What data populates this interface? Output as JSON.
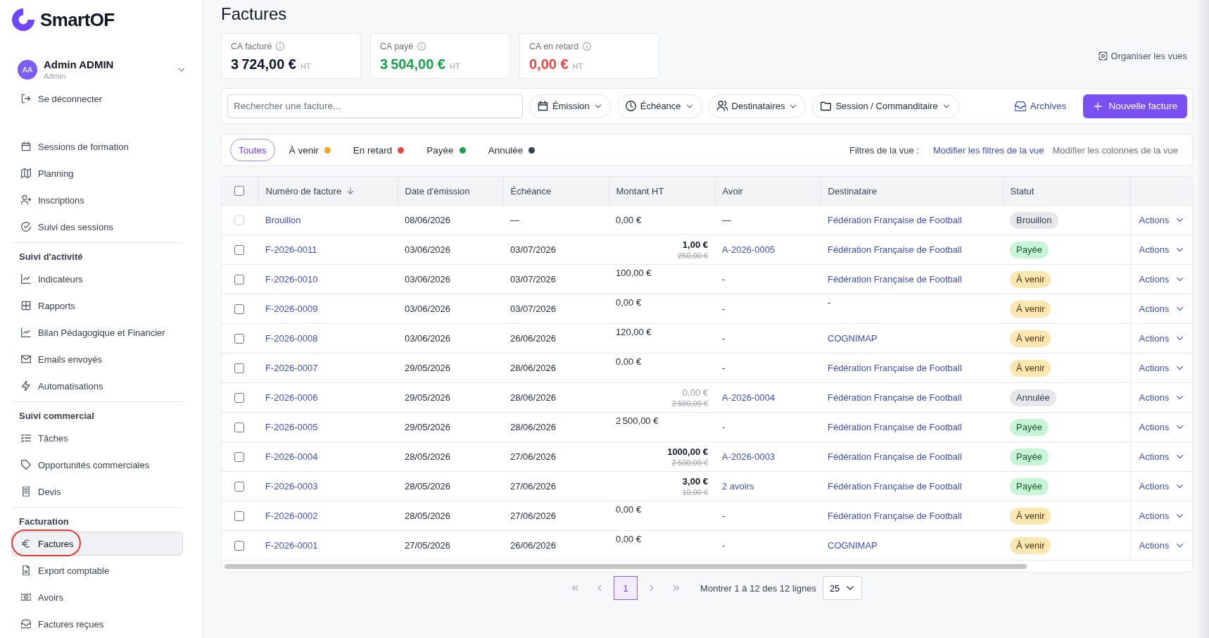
{
  "sidebar": {
    "brand": "SmartOF",
    "user": {
      "initials": "AA",
      "name": "Admin ADMIN",
      "role": "Admin"
    },
    "logout": "Se déconnecter",
    "sections": [
      {
        "items": [
          {
            "label": "Sessions de formation",
            "selected": false,
            "circled": false
          },
          {
            "label": "Planning",
            "selected": false,
            "circled": false
          },
          {
            "label": "Inscriptions",
            "selected": false,
            "circled": false
          },
          {
            "label": "Suivi des sessions",
            "selected": false,
            "circled": false
          }
        ]
      },
      {
        "title": "Suivi d'activité",
        "items": [
          {
            "label": "Indicateurs",
            "selected": false,
            "circled": false
          },
          {
            "label": "Rapports",
            "selected": false,
            "circled": false
          },
          {
            "label": "Bilan Pédagogique et Financier",
            "selected": false,
            "circled": false
          },
          {
            "label": "Emails envoyés",
            "selected": false,
            "circled": false
          },
          {
            "label": "Automatisations",
            "selected": false,
            "circled": false
          }
        ]
      },
      {
        "title": "Suivi commercial",
        "items": [
          {
            "label": "Tâches",
            "selected": false,
            "circled": false
          },
          {
            "label": "Opportunités commerciales",
            "selected": false,
            "circled": false
          },
          {
            "label": "Devis",
            "selected": false,
            "circled": false
          }
        ]
      },
      {
        "title": "Facturation",
        "items": [
          {
            "label": "Factures",
            "selected": true,
            "circled": true
          },
          {
            "label": "Export comptable",
            "selected": false,
            "circled": false
          },
          {
            "label": "Avoirs",
            "selected": false,
            "circled": false
          },
          {
            "label": "Factures reçues",
            "selected": false,
            "circled": false
          }
        ]
      }
    ]
  },
  "page": {
    "title": "Factures",
    "organize_views": "Organiser les vues"
  },
  "stats": [
    {
      "label": "CA facturé",
      "value": "3 724,00 €",
      "unit": "HT",
      "kind": "total"
    },
    {
      "label": "CA payé",
      "value": "3 504,00 €",
      "unit": "HT",
      "kind": "paid"
    },
    {
      "label": "CA en retard",
      "value": "0,00 €",
      "unit": "HT",
      "kind": "overdue"
    }
  ],
  "toolbar": {
    "search": {
      "placeholder": "Rechercher une facture..."
    },
    "filters": [
      {
        "label": "Émission"
      },
      {
        "label": "Échéance"
      },
      {
        "label": "Destinataires"
      },
      {
        "label": "Session / Commanditaire"
      }
    ],
    "archives": "Archives",
    "new_button": "Nouvelle facture"
  },
  "status_tabs": [
    {
      "label": "Toutes",
      "selected": true
    },
    {
      "label": "À venir",
      "selected": false,
      "color": "#f5a524"
    },
    {
      "label": "En retard",
      "selected": false,
      "color": "#ef4444"
    },
    {
      "label": "Payée",
      "selected": false,
      "color": "#16a34a"
    },
    {
      "label": "Annulée",
      "selected": false,
      "color": "#374151"
    }
  ],
  "view_filters": {
    "label": "Filtres de la vue :",
    "edit_filters": "Modifier les filtres de la vue",
    "edit_columns": "Modifier les colonnes de la vue"
  },
  "table": {
    "select_all": {
      "checked": false
    },
    "columns": [
      {
        "label": "Numéro de facture",
        "sorted": true
      },
      {
        "label": "Date d'émission",
        "sorted": false
      },
      {
        "label": "Échéance",
        "sorted": false
      },
      {
        "label": "Montant HT",
        "sorted": false
      },
      {
        "label": "Avoir",
        "sorted": false
      },
      {
        "label": "Destinataire",
        "sorted": false
      },
      {
        "label": "Statut",
        "sorted": false
      }
    ],
    "rows": [
      {
        "checked": false,
        "disabled": true,
        "number": "Brouillon",
        "issued": "08/06/2026",
        "due": "—",
        "amount": {
          "kind": "centered",
          "value": "0,00 €"
        },
        "credit": {
          "kind": "none",
          "text": "—"
        },
        "recipient": {
          "kind": "link",
          "text": "Fédération Française de Football"
        },
        "status": {
          "kind": "draft",
          "label": "Brouillon"
        },
        "action": "Actions"
      },
      {
        "checked": false,
        "disabled": false,
        "number": "F-2026-0011",
        "issued": "03/06/2026",
        "due": "03/07/2026",
        "amount": {
          "kind": "credited",
          "value": "1,00 €",
          "original": "250,00 €"
        },
        "credit": {
          "kind": "link",
          "text": "A-2026-0005"
        },
        "recipient": {
          "kind": "link",
          "text": "Fédération Française de Football"
        },
        "status": {
          "kind": "paid",
          "label": "Payée"
        },
        "action": "Actions"
      },
      {
        "checked": false,
        "disabled": false,
        "number": "F-2026-0010",
        "issued": "03/06/2026",
        "due": "03/07/2026",
        "amount": {
          "kind": "top",
          "value": "100,00 €"
        },
        "credit": {
          "kind": "none",
          "text": "-"
        },
        "recipient": {
          "kind": "link",
          "text": "Fédération Française de Football"
        },
        "status": {
          "kind": "upcoming",
          "label": "À venir"
        },
        "action": "Actions"
      },
      {
        "checked": false,
        "disabled": false,
        "number": "F-2026-0009",
        "issued": "03/06/2026",
        "due": "03/07/2026",
        "amount": {
          "kind": "top",
          "value": "0,00 €"
        },
        "credit": {
          "kind": "none",
          "text": "-"
        },
        "recipient": {
          "kind": "none",
          "text": "-"
        },
        "status": {
          "kind": "upcoming",
          "label": "À venir"
        },
        "action": "Actions"
      },
      {
        "checked": false,
        "disabled": false,
        "number": "F-2026-0008",
        "issued": "03/06/2026",
        "due": "26/06/2026",
        "amount": {
          "kind": "top",
          "value": "120,00 €"
        },
        "credit": {
          "kind": "none",
          "text": "-"
        },
        "recipient": {
          "kind": "link",
          "text": "COGNIMAP"
        },
        "status": {
          "kind": "upcoming",
          "label": "À venir"
        },
        "action": "Actions"
      },
      {
        "checked": false,
        "disabled": false,
        "number": "F-2026-0007",
        "issued": "29/05/2026",
        "due": "28/06/2026",
        "amount": {
          "kind": "top",
          "value": "0,00 €"
        },
        "credit": {
          "kind": "none",
          "text": "-"
        },
        "recipient": {
          "kind": "link",
          "text": "Fédération Française de Football"
        },
        "status": {
          "kind": "upcoming",
          "label": "À venir"
        },
        "action": "Actions"
      },
      {
        "checked": false,
        "disabled": false,
        "number": "F-2026-0006",
        "issued": "29/05/2026",
        "due": "28/06/2026",
        "amount": {
          "kind": "voided",
          "value": "0,00 €",
          "original": "2 500,00 €"
        },
        "credit": {
          "kind": "link",
          "text": "A-2026-0004"
        },
        "recipient": {
          "kind": "link",
          "text": "Fédération Française de Football"
        },
        "status": {
          "kind": "cancelled",
          "label": "Annulée"
        },
        "action": "Actions"
      },
      {
        "checked": false,
        "disabled": false,
        "number": "F-2026-0005",
        "issued": "29/05/2026",
        "due": "28/06/2026",
        "amount": {
          "kind": "top",
          "value": "2 500,00 €"
        },
        "credit": {
          "kind": "none",
          "text": "-"
        },
        "recipient": {
          "kind": "link",
          "text": "Fédération Française de Football"
        },
        "status": {
          "kind": "paid",
          "label": "Payée"
        },
        "action": "Actions"
      },
      {
        "checked": false,
        "disabled": false,
        "number": "F-2026-0004",
        "issued": "28/05/2026",
        "due": "27/06/2026",
        "amount": {
          "kind": "credited",
          "value": "1000,00 €",
          "original": "2 500,00 €"
        },
        "credit": {
          "kind": "link",
          "text": "A-2026-0003"
        },
        "recipient": {
          "kind": "link",
          "text": "Fédération Française de Football"
        },
        "status": {
          "kind": "paid",
          "label": "Payée"
        },
        "action": "Actions"
      },
      {
        "checked": false,
        "disabled": false,
        "number": "F-2026-0003",
        "issued": "28/05/2026",
        "due": "27/06/2026",
        "amount": {
          "kind": "credited",
          "value": "3,00 €",
          "original": "10,00 €"
        },
        "credit": {
          "kind": "link",
          "text": "2 avoirs"
        },
        "recipient": {
          "kind": "link",
          "text": "Fédération Française de Football"
        },
        "status": {
          "kind": "paid",
          "label": "Payée"
        },
        "action": "Actions"
      },
      {
        "checked": false,
        "disabled": false,
        "number": "F-2026-0002",
        "issued": "28/05/2026",
        "due": "27/06/2026",
        "amount": {
          "kind": "top",
          "value": "0,00 €"
        },
        "credit": {
          "kind": "none",
          "text": "-"
        },
        "recipient": {
          "kind": "link",
          "text": "Fédération Française de Football"
        },
        "status": {
          "kind": "upcoming",
          "label": "À venir"
        },
        "action": "Actions"
      },
      {
        "checked": false,
        "disabled": false,
        "number": "F-2026-0001",
        "issued": "27/05/2026",
        "due": "26/06/2026",
        "amount": {
          "kind": "top",
          "value": "0,00 €"
        },
        "credit": {
          "kind": "none",
          "text": "-"
        },
        "recipient": {
          "kind": "link",
          "text": "COGNIMAP"
        },
        "status": {
          "kind": "upcoming",
          "label": "À venir"
        },
        "action": "Actions"
      }
    ]
  },
  "pagination": {
    "pages": [
      {
        "label": "1",
        "selected": true
      }
    ],
    "summary": "Montrer 1 à 12 des 12 lignes",
    "page_size": "25"
  }
}
